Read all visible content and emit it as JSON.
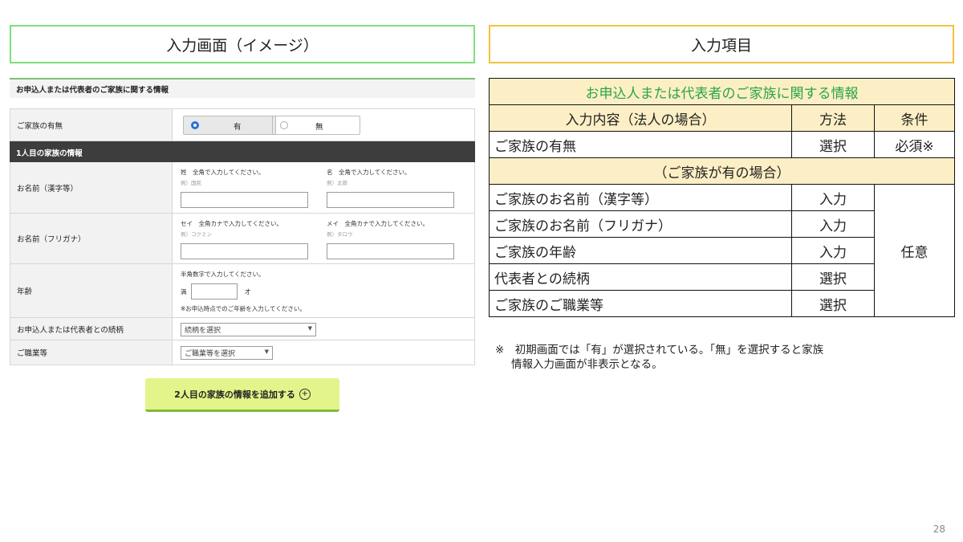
{
  "left_header": "入力画面（イメージ）",
  "right_header": "入力項目",
  "form": {
    "title": "お申込人または代表者のご家族に関する情報",
    "family_label": "ご家族の有無",
    "radio_yes": "有",
    "radio_no": "無",
    "section_title": "1人目の家族の情報",
    "name_kanji_label": "お名前（漢字等）",
    "sei_hint": "姓　全角で入力してください。",
    "sei_example": "例）国民",
    "mei_hint": "名　全角で入力してください。",
    "mei_example": "例）太郎",
    "name_kana_label": "お名前（フリガナ）",
    "sei_kana_hint": "セイ　全角カナで入力してください。",
    "sei_kana_example": "例）コクミン",
    "mei_kana_hint": "メイ　全角カナで入力してください。",
    "mei_kana_example": "例）タロウ",
    "age_label": "年齢",
    "age_hint": "半角数字で入力してください。",
    "age_prefix": "満",
    "age_suffix": "才",
    "age_note": "※お申込時点でのご年齢を入力してください。",
    "relation_label": "お申込人または代表者との続柄",
    "relation_select": "続柄を選択",
    "job_label": "ご職業等",
    "job_select": "ご職業等を選択",
    "add_button": "2人目の家族の情報を追加する"
  },
  "table": {
    "title": "お申込人または代表者のご家族に関する情報",
    "col_content": "入力内容（法人の場合）",
    "col_method": "方法",
    "col_condition": "条件",
    "row1": {
      "item": "ご家族の有無",
      "method": "選択",
      "condition": "必須※"
    },
    "subheader": "（ご家族が有の場合）",
    "rows": [
      {
        "item": "ご家族のお名前（漢字等）",
        "method": "入力"
      },
      {
        "item": "ご家族のお名前（フリガナ）",
        "method": "入力"
      },
      {
        "item": "ご家族の年齢",
        "method": "入力"
      },
      {
        "item": "代表者との続柄",
        "method": "選択"
      },
      {
        "item": "ご家族のご職業等",
        "method": "選択"
      }
    ],
    "optional": "任意"
  },
  "note_line1": "※　初期画面では「有」が選択されている。「無」を選択すると家族",
  "note_line2": "情報入力画面が非表示となる。",
  "page_number": "28"
}
